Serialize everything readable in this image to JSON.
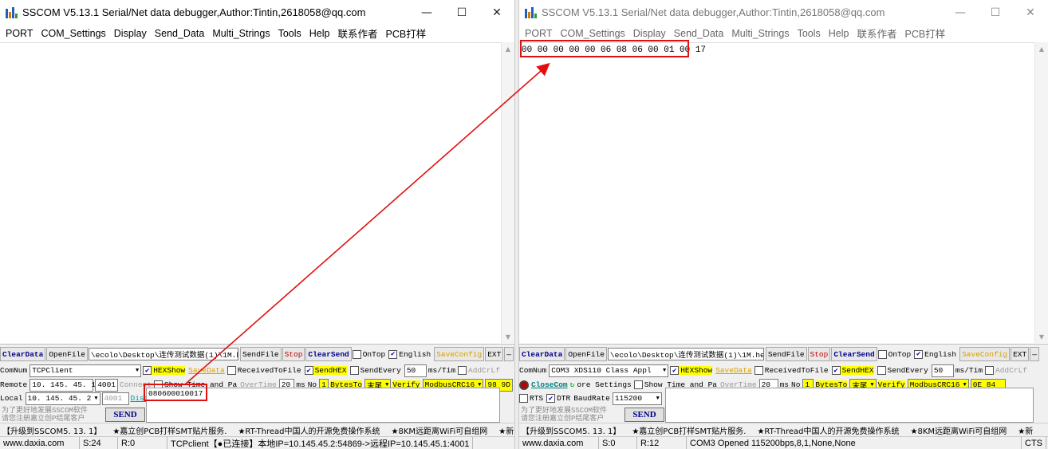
{
  "left": {
    "title": "SSCOM V5.13.1 Serial/Net data debugger,Author:Tintin,2618058@qq.com",
    "menu": [
      "PORT",
      "COM_Settings",
      "Display",
      "Send_Data",
      "Multi_Strings",
      "Tools",
      "Help",
      "联系作者",
      "PCB打样"
    ],
    "recv_text": "",
    "row1": {
      "clear": "ClearData",
      "open": "OpenFile",
      "path": "\\ecolo\\Desktop\\连传测试数据(1)\\1M.hex",
      "sendfile": "SendFile",
      "stop": "Stop",
      "clearsend": "ClearSend",
      "ontop": "OnTop",
      "english": "English",
      "saveconfig": "SaveConfig",
      "ext": "EXT",
      "dash": "—"
    },
    "row2": {
      "comnum": "ComNum",
      "mode": "TCPClient",
      "hexshow": "HEXShow",
      "savedata": "SaveData",
      "received": "ReceivedToFile",
      "sendhex": "SendHEX",
      "sendevery": "SendEvery",
      "period": "50",
      "unit": "ms/Tim",
      "addcrlf": "AddCrLf"
    },
    "row3": {
      "remote_label": "Remote",
      "remote_ip": "10. 145. 45. 1",
      "remote_port": "4001",
      "connect": "Connect",
      "showtime": "Show Time and Pa",
      "overtime": "OverTime",
      "overtime_val": "20",
      "ms": "ms",
      "no": "No",
      "no_val": "1",
      "bytes": "BytesTo",
      "bytes_sel": "末尾",
      "verify": "Verify",
      "crc": "ModbusCRC16",
      "crc_val": "98 9D"
    },
    "row4": {
      "local_label": "Local",
      "local_ip": "10. 145. 45. 2",
      "local_port": "4001",
      "disconnect": "Disconnect"
    },
    "send_text": "080600010017",
    "send_btn": "SEND",
    "promo1": "为了更好地发展SSCOM软件",
    "promo2": "请您注册嘉立创P结尾客户",
    "news": [
      "【升级到SSCOM5. 13. 1】",
      "★嘉立创PCB打样SMT贴片服务.",
      "★RT-Thread中国人的开源免费操作系统",
      "★8KM远距离WiFi可自组网",
      "★新"
    ],
    "status": {
      "site": "www.daxia.com",
      "s": "S:24",
      "r": "R:0",
      "info": "TCPclient【●已连接】本地IP=10.145.45.2:54869->远程IP=10.145.45.1:4001"
    }
  },
  "right": {
    "title": "SSCOM V5.13.1 Serial/Net data debugger,Author:Tintin,2618058@qq.com",
    "menu": [
      "PORT",
      "COM_Settings",
      "Display",
      "Send_Data",
      "Multi_Strings",
      "Tools",
      "Help",
      "联系作者",
      "PCB打样"
    ],
    "recv_text": "00 00 00 00 00 06 08 06 00 01 00 17",
    "row1": {
      "clear": "ClearData",
      "open": "OpenFile",
      "path": "\\ecolo\\Desktop\\连传测试数据(1)\\1M.hex",
      "sendfile": "SendFile",
      "stop": "Stop",
      "clearsend": "ClearSend",
      "ontop": "OnTop",
      "english": "English",
      "saveconfig": "SaveConfig",
      "ext": "EXT",
      "dash": "—"
    },
    "row2": {
      "comnum": "ComNum",
      "mode": "COM3 XDS110 Class Appl",
      "hexshow": "HEXShow",
      "savedata": "SaveData",
      "received": "ReceivedToFile",
      "sendhex": "SendHEX",
      "sendevery": "SendEvery",
      "period": "50",
      "unit": "ms/Tim",
      "addcrlf": "AddCrLf"
    },
    "row3": {
      "closecom": "CloseCom",
      "more": "ore Settings",
      "showtime": "Show Time and Pa",
      "overtime": "OverTime",
      "overtime_val": "20",
      "ms": "ms",
      "no": "No",
      "no_val": "1",
      "bytes": "BytesTo",
      "bytes_sel": "末尾",
      "verify": "Verify",
      "crc": "ModbusCRC16",
      "crc_val": "0E 84"
    },
    "row4": {
      "rts": "RTS",
      "dtr": "DTR",
      "baud_label": "BaudRate",
      "baud": "115200"
    },
    "send_text": "",
    "send_btn": "SEND",
    "promo1": "为了更好地发展SSCOM软件",
    "promo2": "请您注册嘉立创P结尾客户",
    "news": [
      "【升级到SSCOM5. 13. 1】",
      "★嘉立创PCB打样SMT贴片服务.",
      "★RT-Thread中国人的开源免费操作系统",
      "★8KM远距离WiFi可自组网",
      "★新"
    ],
    "status": {
      "site": "www.daxia.com",
      "s": "S:0",
      "r": "R:12",
      "info": "COM3 Opened  115200bps,8,1,None,None",
      "cts": "CTS"
    }
  },
  "colors": {
    "annotation": "#e01010",
    "highlight": "#ffff00"
  }
}
